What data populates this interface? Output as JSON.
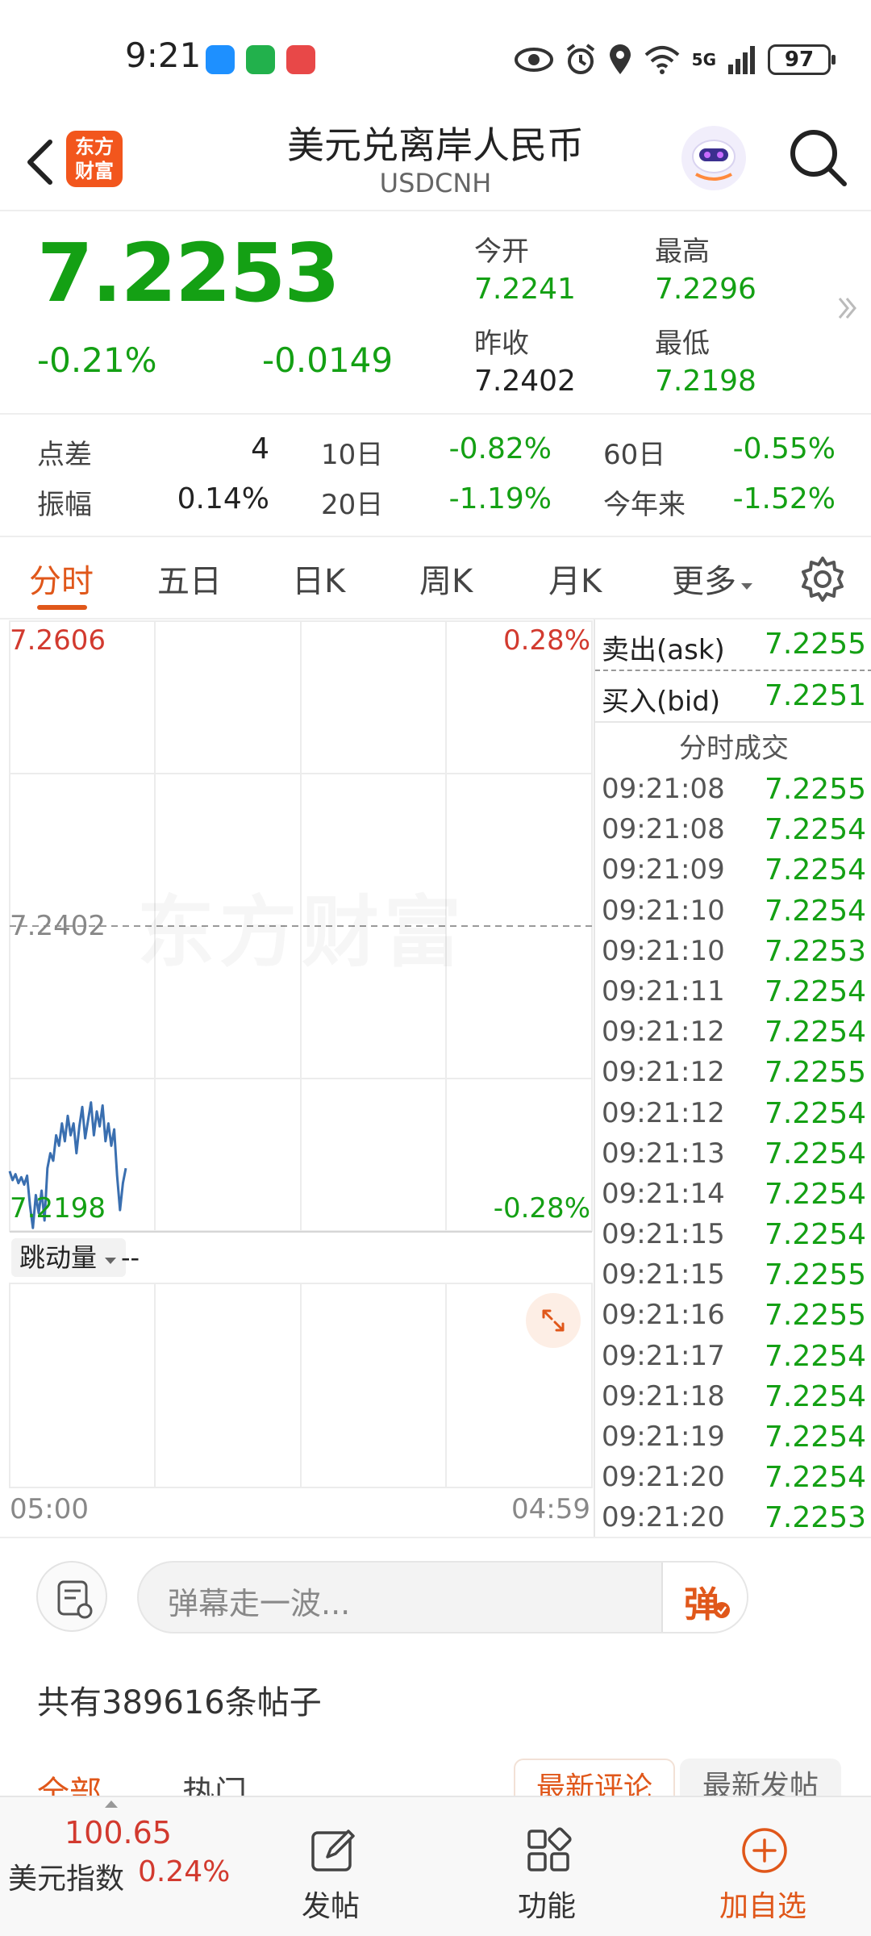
{
  "status": {
    "time": "9:21",
    "network": "5G",
    "battery": "97"
  },
  "header": {
    "title": "美元兑离岸人民币",
    "subtitle": "USDCNH",
    "brand": "东方\n财富"
  },
  "quote": {
    "price": "7.2253",
    "change_pct": "-0.21%",
    "change_abs": "-0.0149",
    "open_label": "今开",
    "open": "7.2241",
    "high_label": "最高",
    "high": "7.2296",
    "prev_close_label": "昨收",
    "prev_close": "7.2402",
    "low_label": "最低",
    "low": "7.2198"
  },
  "stats": {
    "spread_label": "点差",
    "spread": "4",
    "d10_label": "10日",
    "d10": "-0.82%",
    "d60_label": "60日",
    "d60": "-0.55%",
    "amplitude_label": "振幅",
    "amplitude": "0.14%",
    "d20_label": "20日",
    "d20": "-1.19%",
    "ytd_label": "今年来",
    "ytd": "-1.52%"
  },
  "tabs": {
    "intraday": "分时",
    "five_day": "五日",
    "daily": "日K",
    "weekly": "周K",
    "monthly": "月K",
    "more": "更多"
  },
  "chart": {
    "top_price": "7.2606",
    "top_pct": "0.28%",
    "mid_price": "7.2402",
    "bottom_price": "7.2198",
    "bottom_pct": "-0.28%",
    "watermark": "东方财富",
    "indicator": "跳动量",
    "indicator_value": "--",
    "x_start": "05:00",
    "x_end": "04:59",
    "line_color": "#3a6fb0"
  },
  "chart_data": {
    "type": "line",
    "ylim": [
      7.2198,
      7.2606
    ],
    "reference": 7.2402,
    "x": [
      0,
      1,
      2,
      3,
      4,
      5,
      6,
      7,
      8,
      9,
      10,
      11,
      12,
      13,
      14,
      15,
      16,
      17,
      18,
      19,
      20,
      21,
      22,
      23,
      24,
      25,
      26,
      27,
      28,
      29,
      30,
      31,
      32,
      33,
      34,
      35,
      36,
      37,
      38,
      39,
      40
    ],
    "values": [
      7.2238,
      7.2232,
      7.2236,
      7.223,
      7.2234,
      7.2229,
      7.2235,
      7.2215,
      7.22,
      7.2222,
      7.221,
      7.2225,
      7.2205,
      7.224,
      7.225,
      7.2245,
      7.2262,
      7.2255,
      7.227,
      7.2258,
      7.2275,
      7.2262,
      7.227,
      7.225,
      7.2268,
      7.2281,
      7.226,
      7.2272,
      7.2284,
      7.2262,
      7.2278,
      7.2268,
      7.2282,
      7.2258,
      7.227,
      7.2255,
      7.2266,
      7.2235,
      7.2212,
      7.223,
      7.224
    ]
  },
  "orderbook": {
    "ask_label": "卖出(ask)",
    "ask": "7.2255",
    "bid_label": "买入(bid)",
    "bid": "7.2251",
    "title": "分时成交"
  },
  "trades": [
    {
      "time": "09:21:08",
      "price": "7.2255"
    },
    {
      "time": "09:21:08",
      "price": "7.2254"
    },
    {
      "time": "09:21:09",
      "price": "7.2254"
    },
    {
      "time": "09:21:10",
      "price": "7.2254"
    },
    {
      "time": "09:21:10",
      "price": "7.2253"
    },
    {
      "time": "09:21:11",
      "price": "7.2254"
    },
    {
      "time": "09:21:12",
      "price": "7.2254"
    },
    {
      "time": "09:21:12",
      "price": "7.2255"
    },
    {
      "time": "09:21:12",
      "price": "7.2254"
    },
    {
      "time": "09:21:13",
      "price": "7.2254"
    },
    {
      "time": "09:21:14",
      "price": "7.2254"
    },
    {
      "time": "09:21:15",
      "price": "7.2254"
    },
    {
      "time": "09:21:15",
      "price": "7.2255"
    },
    {
      "time": "09:21:16",
      "price": "7.2255"
    },
    {
      "time": "09:21:17",
      "price": "7.2254"
    },
    {
      "time": "09:21:18",
      "price": "7.2254"
    },
    {
      "time": "09:21:19",
      "price": "7.2254"
    },
    {
      "time": "09:21:20",
      "price": "7.2254"
    },
    {
      "time": "09:21:20",
      "price": "7.2253"
    }
  ],
  "comment": {
    "placeholder": "弹幕走一波...",
    "send_label": "弹"
  },
  "posts": {
    "count_text": "共有389616条帖子",
    "tab_all": "全部",
    "tab_hot": "热门",
    "sort_latest_comment": "最新评论",
    "sort_latest_post": "最新发帖"
  },
  "bottom_nav": {
    "index_value": "100.65",
    "index_name": "美元指数",
    "index_change": "0.24%",
    "post": "发帖",
    "function": "功能",
    "add_watch": "加自选"
  },
  "colors": {
    "up": "#d23a2f",
    "down": "#14a014",
    "accent": "#e0571a"
  }
}
